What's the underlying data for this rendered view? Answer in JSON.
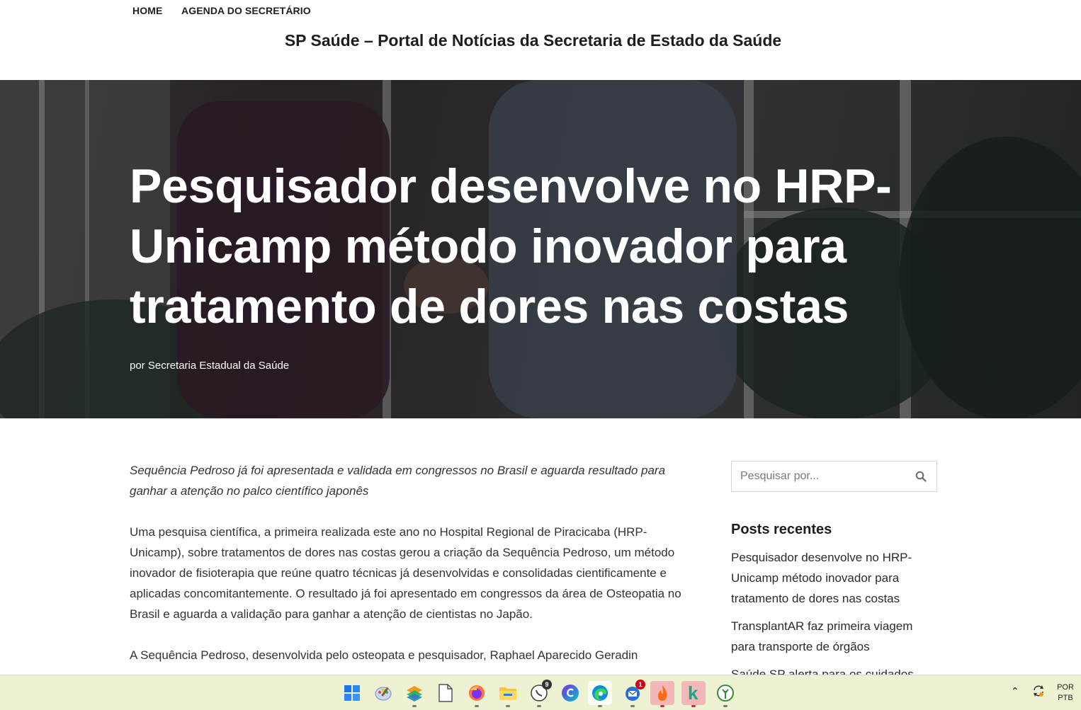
{
  "nav": {
    "home": "HOME",
    "agenda": "AGENDA DO SECRETÁRIO"
  },
  "site_title": "SP Saúde – Portal de Notícias da Secretaria de Estado da Saúde",
  "hero": {
    "title": "Pesquisador desenvolve no HRP-Unicamp método inovador para tratamento de dores nas costas",
    "byline": "por Secretaria Estadual da Saúde"
  },
  "article": {
    "lead": "Sequência Pedroso já foi apresentada e validada em congressos no Brasil e aguarda resultado para ganhar a atenção no palco científico japonês",
    "paragraph1": "Uma pesquisa científica, a primeira realizada este ano no Hospital Regional de Piracicaba (HRP-Unicamp), sobre tratamentos de dores nas costas gerou a criação da Sequência Pedroso, um método inovador de fisioterapia que reúne quatro técnicas já desenvolvidas e consolidadas cientificamente e aplicadas concomitantemente. O resultado já foi apresentado em congressos da área de Osteopatia no Brasil e aguarda a validação para ganhar a atenção de cientistas no Japão.",
    "paragraph2": "A Sequência Pedroso, desenvolvida pelo osteopata e pesquisador, Raphael Aparecido Geradin"
  },
  "sidebar": {
    "search_placeholder": "Pesquisar por...",
    "recent_title": "Posts recentes",
    "recent_posts": [
      "Pesquisador desenvolve no HRP-Unicamp método inovador para tratamento de dores nas costas",
      "TransplantAR faz primeira viagem para transporte de órgãos",
      "Saúde SP alerta para os cuidados"
    ]
  },
  "taskbar": {
    "whatsapp_badge": "9",
    "thunderbird_badge": "1",
    "lang_top": "POR",
    "lang_bottom": "PTB",
    "icons": [
      "windows-start",
      "paint",
      "layers-app",
      "files",
      "firefox",
      "file-explorer",
      "whatsapp",
      "canva",
      "edge",
      "thunderbird",
      "flame-app",
      "k-app",
      "tree-app"
    ]
  },
  "colors": {
    "taskbar_bg": "#eef2d3",
    "title_text": "#1d1d1d",
    "hero_text": "#ffffff"
  }
}
